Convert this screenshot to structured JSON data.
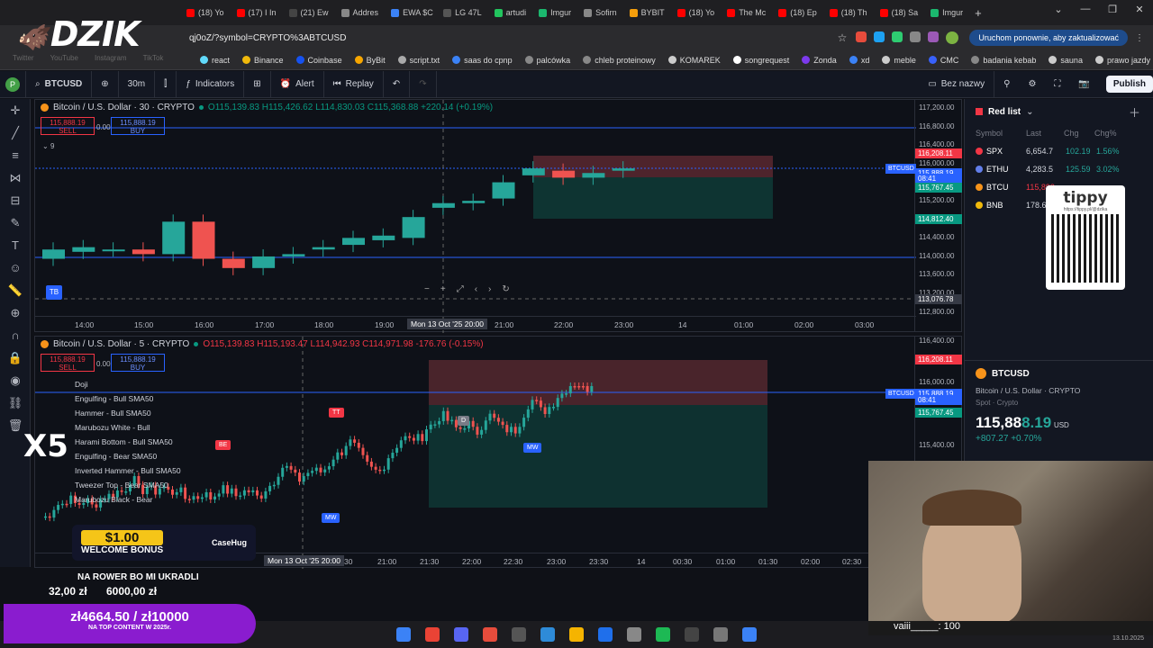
{
  "logo": "DZIK",
  "browser": {
    "tabs": [
      {
        "label": "(18) Yo",
        "color": "#ff0000"
      },
      {
        "label": "(17) I In",
        "color": "#ff0000"
      },
      {
        "label": "(21) Ew",
        "color": "#444"
      },
      {
        "label": "Addres",
        "color": "#888"
      },
      {
        "label": "EWA $C",
        "color": "#3b82f6"
      },
      {
        "label": "LG 47L",
        "color": "#555"
      },
      {
        "label": "artudi",
        "color": "#22c55e"
      },
      {
        "label": "Imgur",
        "color": "#1bb76e"
      },
      {
        "label": "Sofirn",
        "color": "#888"
      },
      {
        "label": "BYBIT",
        "color": "#f59e0b"
      },
      {
        "label": "(18) Yo",
        "color": "#ff0000"
      },
      {
        "label": "The Mc",
        "color": "#ff0000"
      },
      {
        "label": "(18) Ep",
        "color": "#ff0000"
      },
      {
        "label": "(18) Th",
        "color": "#ff0000"
      },
      {
        "label": "(18) Sa",
        "color": "#ff0000"
      },
      {
        "label": "Imgur",
        "color": "#1bb76e"
      }
    ],
    "new_tab": "+",
    "url": "qj0oZ/?symbol=CRYPTO%3ABTCUSD",
    "update_button": "Uruchom ponownie, aby zaktualizować",
    "bookmarks_left": [
      "Twitter",
      "YouTube",
      "Instagram",
      "TikTok"
    ],
    "bookmarks": [
      {
        "label": "react",
        "color": "#61dafb"
      },
      {
        "label": "Binance",
        "color": "#f0b90b"
      },
      {
        "label": "Coinbase",
        "color": "#1652f0"
      },
      {
        "label": "ByBit",
        "color": "#f7a600"
      },
      {
        "label": "script.txt",
        "color": "#aaa"
      },
      {
        "label": "saas do cpnp",
        "color": "#3b82f6"
      },
      {
        "label": "palcówka",
        "color": "#888"
      },
      {
        "label": "chleb proteinowy",
        "color": "#888"
      },
      {
        "label": "KOMAREK",
        "color": "#ccc"
      },
      {
        "label": "songrequest",
        "color": "#fff"
      },
      {
        "label": "Zonda",
        "color": "#7c3aed"
      },
      {
        "label": "xd",
        "color": "#3b82f6"
      },
      {
        "label": "meble",
        "color": "#ccc"
      },
      {
        "label": "CMC",
        "color": "#3861fb"
      },
      {
        "label": "badania kebab",
        "color": "#888"
      },
      {
        "label": "sauna",
        "color": "#ccc"
      },
      {
        "label": "prawo jazdy",
        "color": "#ccc"
      }
    ]
  },
  "toolbar": {
    "symbol": "BTCUSD",
    "interval": "30m",
    "indicators": "Indicators",
    "alert": "Alert",
    "replay": "Replay",
    "layout_name": "Bez nazwy",
    "publish": "Publish"
  },
  "chart1": {
    "header": "Bitcoin / U.S. Dollar · 30 · CRYPTO",
    "ohlc": {
      "o": "115,139.83",
      "h": "115,426.62",
      "l": "114,830.03",
      "c": "115,368.88",
      "chg": "+220.14 (+0.19%)"
    },
    "sell": "115,888.19",
    "sell_label": "SELL",
    "spread": "0.00",
    "buy": "115,888.19",
    "buy_label": "BUY",
    "indicator_count": "9",
    "price_ticks": [
      "117,200.00",
      "116,800.00",
      "116,400.00",
      "116,000.00",
      "115,600.00",
      "115,200.00",
      "114,800.00",
      "114,400.00",
      "114,000.00",
      "113,600.00",
      "113,200.00",
      "112,800.00"
    ],
    "labels": {
      "red": "116,208.11",
      "ticker": "BTCUSD",
      "current": "115,888.19",
      "countdown": "08:41",
      "teal": "115,767.45",
      "green": "114,812.40",
      "crosshair": "113,076.78"
    },
    "time_ticks": [
      "14:00",
      "15:00",
      "16:00",
      "17:00",
      "18:00",
      "19:00",
      "21:00",
      "22:00",
      "23:00",
      "14",
      "01:00",
      "02:00",
      "03:00"
    ],
    "crosshair_time": "Mon 13 Oct '25  20:00",
    "tb_badge": "TB",
    "chart_data": {
      "type": "candlestick",
      "interval": "30m",
      "ylim": [
        112800,
        117200
      ],
      "candles": [
        [
          0,
          113850,
          114050,
          113850
        ],
        [
          1,
          114000,
          114100,
          114000
        ],
        [
          2,
          114050,
          114050,
          114050
        ],
        [
          3,
          114050,
          113950,
          113950
        ],
        [
          4,
          113950,
          114650,
          114650
        ],
        [
          5,
          114650,
          113850,
          113850
        ],
        [
          6,
          113850,
          113650,
          113650
        ],
        [
          7,
          113650,
          113900,
          113900
        ],
        [
          8,
          113900,
          113950,
          113950
        ],
        [
          9,
          114050,
          114100,
          114100
        ],
        [
          10,
          114150,
          114300,
          114300
        ],
        [
          11,
          114250,
          114350,
          114350
        ],
        [
          12,
          114300,
          114750,
          114750
        ],
        [
          13,
          114950,
          115050,
          115050
        ],
        [
          14,
          115050,
          115100,
          115100
        ],
        [
          15,
          115150,
          115500,
          115500
        ],
        [
          16,
          115650,
          115800,
          115800
        ],
        [
          17,
          115750,
          115600,
          115600
        ],
        [
          18,
          115600,
          115700,
          115700
        ],
        [
          19,
          115750,
          115800,
          115800
        ]
      ]
    }
  },
  "chart2": {
    "header": "Bitcoin / U.S. Dollar · 5 · CRYPTO",
    "ohlc": {
      "o": "115,139.83",
      "h": "115,193.47",
      "l": "114,942.93",
      "c": "114,971.98",
      "chg": "-176.76 (-0.15%)"
    },
    "sell": "115,888.19",
    "sell_label": "SELL",
    "spread": "0.00",
    "buy": "115,888.19",
    "buy_label": "BUY",
    "price_ticks": [
      "116,400.00",
      "116,000.00",
      "115,600.00",
      "115,400.00"
    ],
    "labels": {
      "red": "116,208.11",
      "ticker": "BTCUSD",
      "current": "115,888.19",
      "countdown": "08:41",
      "teal": "115,767.45"
    },
    "patterns": [
      "Doji",
      "Engulfing - Bull SMA50",
      "Hammer - Bull SMA50",
      "Marubozu White - Bull",
      "Harami Bottom - Bull SMA50",
      "Engulfing - Bear SMA50",
      "Inverted Hammer - Bull SMA50",
      "Tweezer Top - Bear SMA50",
      "Marubozu Black - Bear"
    ],
    "time_ticks": [
      "30",
      "21:00",
      "21:30",
      "22:00",
      "22:30",
      "23:00",
      "23:30",
      "14",
      "00:30",
      "01:00",
      "01:30",
      "02:00",
      "02:30"
    ],
    "crosshair_time": "Mon 13 Oct '25  20:00",
    "badges": [
      "BE",
      "TT",
      "D",
      "MW",
      "MW"
    ]
  },
  "watchlist": {
    "title": "Red list",
    "cols": [
      "Symbol",
      "Last",
      "Chg",
      "Chg%"
    ],
    "rows": [
      {
        "sym": "SPX",
        "last": "6,654.7",
        "chg": "102.19",
        "pct": "1.56%",
        "color": "#f23645"
      },
      {
        "sym": "ETHU",
        "last": "4,283.5",
        "chg": "125.59",
        "pct": "3.02%",
        "color": "#627eea"
      },
      {
        "sym": "BTCU",
        "last": "115,892",
        "chg": "",
        "pct": "",
        "color": "#f7931a"
      },
      {
        "sym": "BNB",
        "last": "178.65 B",
        "chg": "",
        "pct": "",
        "color": "#f0b90b"
      }
    ]
  },
  "details": {
    "symbol": "BTCUSD",
    "name": "Bitcoin / U.S. Dollar",
    "exchange": "CRYPTO",
    "type": "Spot",
    "category": "Crypto",
    "price_main": "115,88",
    "price_tail": "8.19",
    "currency": "USD",
    "change": "+807.27",
    "change_pct": "+0.70%"
  },
  "tippy": {
    "brand": "tippy",
    "url": "https://tippy.pl/@dzika"
  },
  "promo": {
    "amount": "$1.00",
    "text": "WELCOME BONUS",
    "brand": "CaseHug",
    "x5": "X5"
  },
  "stream": {
    "message": "NA ROWER BO MI UKRADLI",
    "left": "32,00 zł",
    "right": "6000,00 zł",
    "goal": "zł4664.50 / zł10000",
    "goal_sub": "NA TOP CONTENT W 2025r.",
    "chat_user": "vaiii_____:",
    "chat_value": "100"
  },
  "tray": {
    "date": "13.10.2025"
  }
}
